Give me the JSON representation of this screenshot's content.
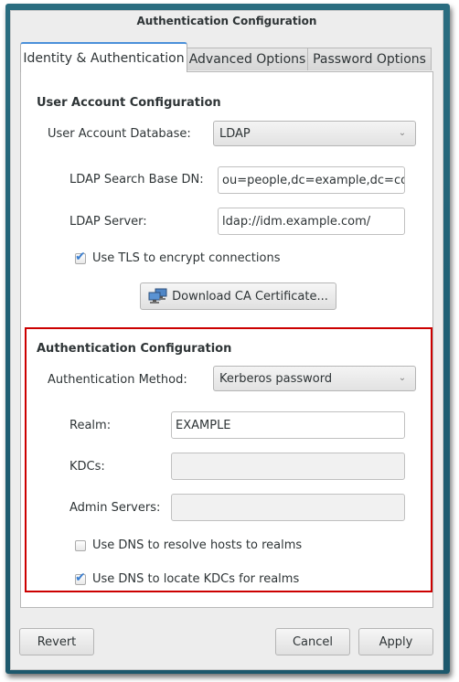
{
  "window": {
    "title": "Authentication Configuration"
  },
  "tabs": [
    {
      "label": "Identity & Authentication",
      "active": true
    },
    {
      "label": "Advanced Options",
      "active": false
    },
    {
      "label": "Password Options",
      "active": false
    }
  ],
  "user_account": {
    "section_title": "User Account Configuration",
    "database_label": "User Account Database:",
    "database_value": "LDAP",
    "search_base_label": "LDAP Search Base DN:",
    "search_base_value": "ou=people,dc=example,dc=com",
    "server_label": "LDAP Server:",
    "server_value": "ldap://idm.example.com/",
    "tls_label": "Use TLS to encrypt connections",
    "tls_checked": true,
    "download_ca_label": "Download CA Certificate..."
  },
  "auth_config": {
    "section_title": "Authentication Configuration",
    "method_label": "Authentication Method:",
    "method_value": "Kerberos password",
    "realm_label": "Realm:",
    "realm_value": "EXAMPLE",
    "kdcs_label": "KDCs:",
    "kdcs_value": "",
    "admin_servers_label": "Admin Servers:",
    "admin_servers_value": "",
    "dns_hosts_label": "Use DNS to resolve hosts to realms",
    "dns_hosts_checked": false,
    "dns_kdcs_label": "Use DNS to locate KDCs for realms",
    "dns_kdcs_checked": true
  },
  "footer": {
    "revert_label": "Revert",
    "cancel_label": "Cancel",
    "apply_label": "Apply"
  },
  "icons": {
    "combo_arrow": "chevron-down-icon",
    "check": "checkmark-icon",
    "download": "network-icon"
  },
  "colors": {
    "highlight": "#cc0000",
    "active_tab_accent": "#4a90d9",
    "checkmark": "#3b7fd0",
    "desktop": "#1f5f74"
  }
}
